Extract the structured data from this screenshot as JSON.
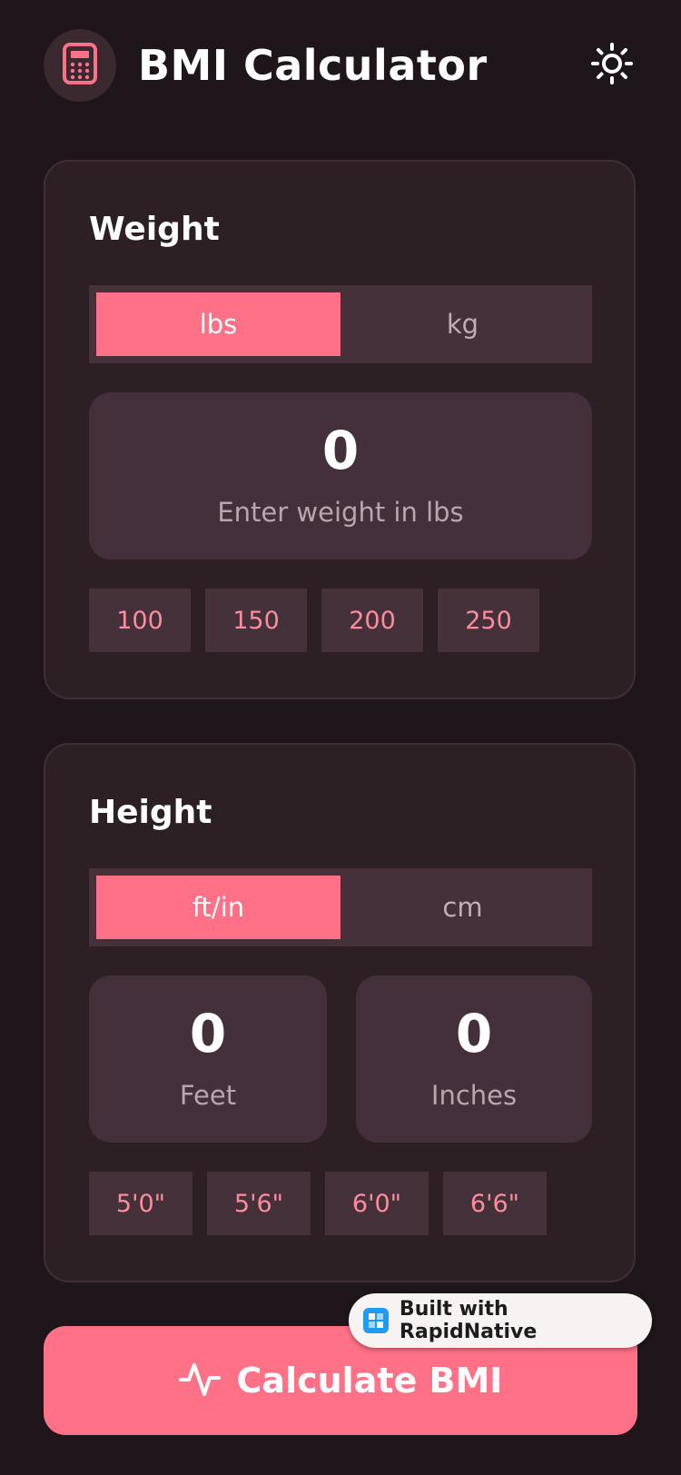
{
  "header": {
    "title": "BMI Calculator",
    "logo_icon": "calculator-icon",
    "theme_icon": "sun-icon"
  },
  "weight": {
    "title": "Weight",
    "units": [
      {
        "label": "lbs",
        "active": true
      },
      {
        "label": "kg",
        "active": false
      }
    ],
    "value": "0",
    "hint": "Enter weight in lbs",
    "presets": [
      "100",
      "150",
      "200",
      "250"
    ]
  },
  "height": {
    "title": "Height",
    "units": [
      {
        "label": "ft/in",
        "active": true
      },
      {
        "label": "cm",
        "active": false
      }
    ],
    "feet": {
      "value": "0",
      "label": "Feet"
    },
    "inches": {
      "value": "0",
      "label": "Inches"
    },
    "presets": [
      "5'0\"",
      "5'6\"",
      "6'0\"",
      "6'6\""
    ]
  },
  "calculate": {
    "label": "Calculate BMI",
    "icon": "activity-icon"
  },
  "badge": {
    "label": "Built with RapidNative",
    "icon": "rapidnative-icon"
  },
  "colors": {
    "background": "#1e161b",
    "card": "#2c2025",
    "accent": "#ff7186",
    "preset_text": "#ff8b9e"
  }
}
